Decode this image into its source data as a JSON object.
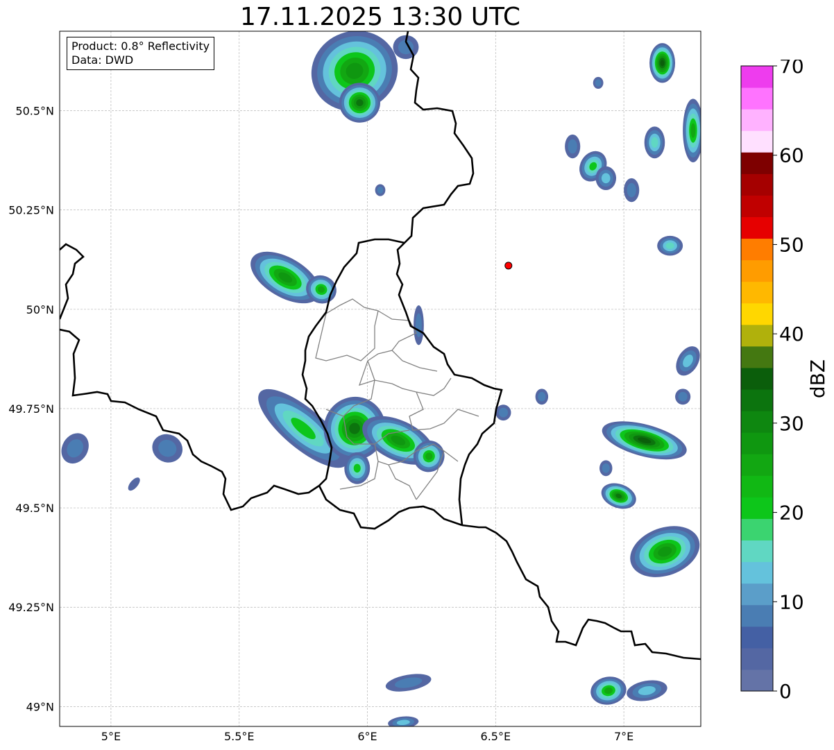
{
  "title": "17.11.2025 13:30 UTC",
  "info": {
    "product": "Product: 0.8° Reflectivity",
    "data": "Data: DWD"
  },
  "axes": {
    "x_ticks": [
      {
        "value": 5.0,
        "label": "5°E"
      },
      {
        "value": 5.5,
        "label": "5.5°E"
      },
      {
        "value": 6.0,
        "label": "6°E"
      },
      {
        "value": 6.5,
        "label": "6.5°E"
      },
      {
        "value": 7.0,
        "label": "7°E"
      }
    ],
    "y_ticks": [
      {
        "value": 50.5,
        "label": "50.5°N"
      },
      {
        "value": 50.25,
        "label": "50.25°N"
      },
      {
        "value": 50.0,
        "label": "50°N"
      },
      {
        "value": 49.75,
        "label": "49.75°N"
      },
      {
        "value": 49.5,
        "label": "49.5°N"
      },
      {
        "value": 49.25,
        "label": "49.25°N"
      },
      {
        "value": 49.0,
        "label": "49°N"
      }
    ],
    "lon_range": [
      4.8,
      7.3
    ],
    "lat_range": [
      48.95,
      50.7
    ],
    "grid": true
  },
  "radar_site": {
    "lon": 6.55,
    "lat": 50.11,
    "color": "#ff0000"
  },
  "colorbar": {
    "label": "dBZ",
    "min": 0,
    "max": 70,
    "step": 2.5,
    "tick_labels": [
      "0",
      "10",
      "20",
      "30",
      "40",
      "50",
      "60",
      "70"
    ],
    "colors": [
      "#6473a7",
      "#5467a3",
      "#4460a4",
      "#4a7db3",
      "#5b9ec9",
      "#64c2dc",
      "#60d7c2",
      "#3bd470",
      "#0dc61a",
      "#11b814",
      "#12a712",
      "#0f9710",
      "#0e8710",
      "#0c740e",
      "#0b5e0b",
      "#447811",
      "#b0b10c",
      "#ffd700",
      "#ffb800",
      "#ff9c00",
      "#ff7d00",
      "#e60000",
      "#c00000",
      "#a50000",
      "#7e0000",
      "#ffe0ff",
      "#ffb2ff",
      "#ff73ff",
      "#ee3cee"
    ]
  },
  "precip_cells": [
    {
      "lon": 5.95,
      "lat": 50.6,
      "rx": 0.17,
      "ry": 0.1,
      "rot": -20,
      "peak": 30
    },
    {
      "lon": 5.97,
      "lat": 50.52,
      "rx": 0.08,
      "ry": 0.05,
      "rot": 0,
      "peak": 33
    },
    {
      "lon": 7.15,
      "lat": 50.62,
      "rx": 0.05,
      "ry": 0.05,
      "rot": 0,
      "peak": 40
    },
    {
      "lon": 7.27,
      "lat": 50.45,
      "rx": 0.04,
      "ry": 0.08,
      "rot": 0,
      "peak": 25
    },
    {
      "lon": 7.12,
      "lat": 50.42,
      "rx": 0.04,
      "ry": 0.04,
      "rot": 0,
      "peak": 20
    },
    {
      "lon": 6.88,
      "lat": 50.36,
      "rx": 0.05,
      "ry": 0.04,
      "rot": 30,
      "peak": 22
    },
    {
      "lon": 6.93,
      "lat": 50.33,
      "rx": 0.04,
      "ry": 0.03,
      "rot": 0,
      "peak": 15
    },
    {
      "lon": 6.8,
      "lat": 50.41,
      "rx": 0.03,
      "ry": 0.03,
      "rot": 0,
      "peak": 12
    },
    {
      "lon": 7.03,
      "lat": 50.3,
      "rx": 0.03,
      "ry": 0.03,
      "rot": 0,
      "peak": 10
    },
    {
      "lon": 7.18,
      "lat": 50.16,
      "rx": 0.05,
      "ry": 0.025,
      "rot": 0,
      "peak": 18
    },
    {
      "lon": 5.68,
      "lat": 50.08,
      "rx": 0.15,
      "ry": 0.05,
      "rot": 30,
      "peak": 32
    },
    {
      "lon": 5.82,
      "lat": 50.05,
      "rx": 0.06,
      "ry": 0.035,
      "rot": 20,
      "peak": 28
    },
    {
      "lon": 6.2,
      "lat": 49.96,
      "rx": 0.02,
      "ry": 0.05,
      "rot": 0,
      "peak": 10
    },
    {
      "lon": 5.75,
      "lat": 49.7,
      "rx": 0.22,
      "ry": 0.05,
      "rot": 40,
      "peak": 22
    },
    {
      "lon": 5.95,
      "lat": 49.7,
      "rx": 0.12,
      "ry": 0.08,
      "rot": 20,
      "peak": 33
    },
    {
      "lon": 6.12,
      "lat": 49.67,
      "rx": 0.15,
      "ry": 0.05,
      "rot": 25,
      "peak": 30
    },
    {
      "lon": 5.96,
      "lat": 49.6,
      "rx": 0.05,
      "ry": 0.04,
      "rot": 0,
      "peak": 22
    },
    {
      "lon": 6.24,
      "lat": 49.63,
      "rx": 0.06,
      "ry": 0.04,
      "rot": 30,
      "peak": 25
    },
    {
      "lon": 7.08,
      "lat": 49.67,
      "rx": 0.17,
      "ry": 0.04,
      "rot": 15,
      "peak": 37
    },
    {
      "lon": 6.98,
      "lat": 49.53,
      "rx": 0.07,
      "ry": 0.03,
      "rot": 20,
      "peak": 35
    },
    {
      "lon": 7.16,
      "lat": 49.39,
      "rx": 0.14,
      "ry": 0.06,
      "rot": -20,
      "peak": 30
    },
    {
      "lon": 4.86,
      "lat": 49.65,
      "rx": 0.05,
      "ry": 0.04,
      "rot": 30,
      "peak": 10
    },
    {
      "lon": 5.22,
      "lat": 49.65,
      "rx": 0.06,
      "ry": 0.035,
      "rot": 25,
      "peak": 9
    },
    {
      "lon": 5.09,
      "lat": 49.56,
      "rx": 0.015,
      "ry": 0.02,
      "rot": 40,
      "peak": 6
    },
    {
      "lon": 6.94,
      "lat": 49.04,
      "rx": 0.07,
      "ry": 0.035,
      "rot": -10,
      "peak": 28
    },
    {
      "lon": 7.09,
      "lat": 49.04,
      "rx": 0.08,
      "ry": 0.025,
      "rot": -10,
      "peak": 15
    },
    {
      "lon": 6.16,
      "lat": 49.06,
      "rx": 0.09,
      "ry": 0.02,
      "rot": -10,
      "peak": 12
    },
    {
      "lon": 6.14,
      "lat": 48.96,
      "rx": 0.06,
      "ry": 0.015,
      "rot": -5,
      "peak": 16
    },
    {
      "lon": 7.25,
      "lat": 49.87,
      "rx": 0.04,
      "ry": 0.04,
      "rot": 30,
      "peak": 14
    },
    {
      "lon": 6.68,
      "lat": 49.78,
      "rx": 0.025,
      "ry": 0.02,
      "rot": 0,
      "peak": 12
    },
    {
      "lon": 6.53,
      "lat": 49.74,
      "rx": 0.03,
      "ry": 0.02,
      "rot": 0,
      "peak": 10
    },
    {
      "lon": 6.9,
      "lat": 50.57,
      "rx": 0.02,
      "ry": 0.015,
      "rot": 0,
      "peak": 10
    },
    {
      "lon": 6.15,
      "lat": 50.66,
      "rx": 0.05,
      "ry": 0.03,
      "rot": 0,
      "peak": 12
    },
    {
      "lon": 6.05,
      "lat": 50.3,
      "rx": 0.02,
      "ry": 0.015,
      "rot": 0,
      "peak": 8
    },
    {
      "lon": 6.93,
      "lat": 49.6,
      "rx": 0.025,
      "ry": 0.02,
      "rot": 0,
      "peak": 12
    },
    {
      "lon": 7.23,
      "lat": 49.78,
      "rx": 0.03,
      "ry": 0.02,
      "rot": 0,
      "peak": 12
    }
  ]
}
